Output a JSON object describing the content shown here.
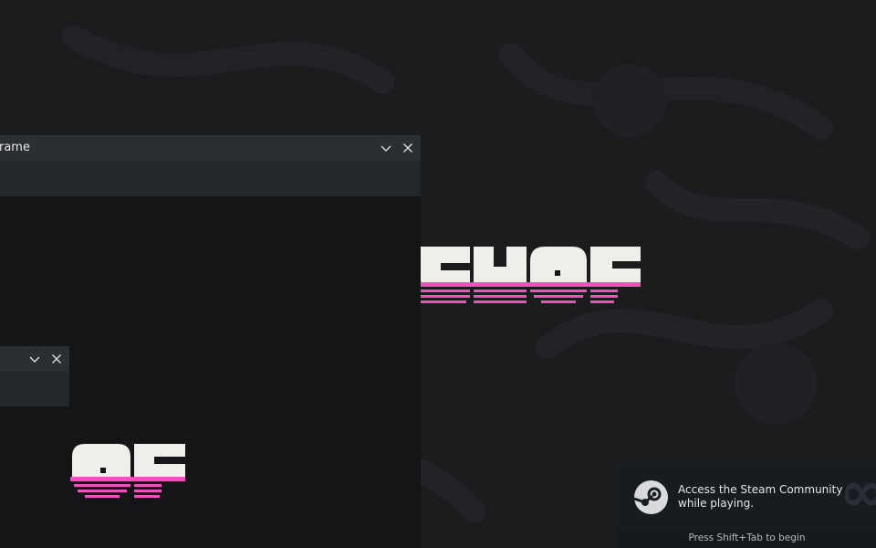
{
  "windows": {
    "main": {
      "title_fragment": "rame"
    },
    "secondary": {
      "title_fragment": ""
    }
  },
  "icons": [
    "chevron-down-icon",
    "close-icon",
    "steam-logo-icon"
  ],
  "colors": {
    "desktop_bg": "#1b1c1e",
    "titlebar": "#2b2e32",
    "logo_white": "#f0eeea",
    "logo_pink": "#f050bc",
    "notification_bg": "#181c21"
  },
  "notification": {
    "message": "Access the Steam Community while playing.",
    "hint": "Press Shift+Tab to begin"
  }
}
